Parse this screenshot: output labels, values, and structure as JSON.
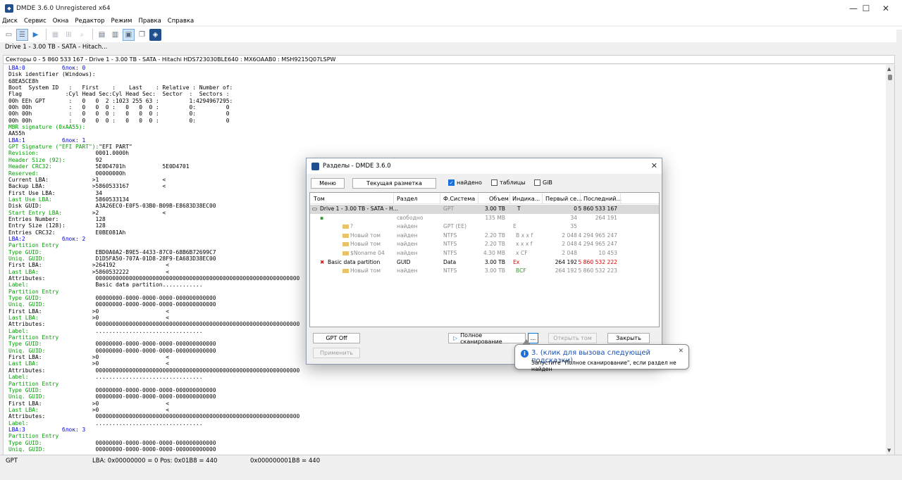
{
  "window": {
    "title": "DMDE 3.6.0 Unregistered x64",
    "icon": "dmde-app-icon",
    "min": "—",
    "max": "☐",
    "close": "✕"
  },
  "menu": [
    "Диск",
    "Сервис",
    "Окна",
    "Редактор",
    "Режим",
    "Правка",
    "Справка"
  ],
  "toolbar": {
    "icons": [
      "disk-icon",
      "list-view-icon",
      "play-icon",
      "grid-icon",
      "zoom-icon",
      "search-icon",
      "panel1-icon",
      "panel2-icon",
      "panel3-icon",
      "window-icon",
      "dmde-icon"
    ]
  },
  "doc_tab": "Drive 1 - 3.00 TB - SATA - Hitach...",
  "panel_header": "Секторы 0 - 5 860 533 167 - Drive 1 - 3.00 TB - SATA - Hitachi HDS723030BLE640 : MX6OAAB0 : MSH9215Q07LSPW",
  "hex_lines": [
    "LBA:0           блок: 0",
    "Disk identifier (Windows):",
    "68EA5CE8h",
    "Boot  System ID   :   First    :    Last    : Relative : Number of:",
    "Flag             :Cyl Head Sec:Cyl Head Sec:  Sector  :  Sectors :",
    "00h EEh GPT       :   0   0  2 :1023 255 63 :         1:4294967295:",
    "00h 00h           :   0   0  0 :   0   0  0 :         0:         0",
    "00h 00h           :   0   0  0 :   0   0  0 :         0:         0",
    "00h 00h           :   0   0  0 :   0   0  0 :         0:         0",
    "MBR signature (0xAA55):",
    "AA55h",
    "LBA:1           блок: 1",
    "GPT Signature (\"EFI PART\"):\"EFI PART\"",
    "Revision:                 0001.0000h",
    "Header Size (92):         92",
    "Header CRC32:             5E0D4701h           5E0D4701",
    "Reserved:                 00000000h",
    "Current LBA:             >1                   <",
    "Backup LBA:              >5860533167          <",
    "First Use LBA:            34",
    "Last Use LBA:             5860533134",
    "Disk GUID:                A3A26EC0-E0F5-03B0-B09B-E8683D38EC00",
    "Start Entry LBA:         >2                   <",
    "Entries Number:           128",
    "Entry Size (128):         128",
    "Entries CRC32:            E0BE081Ah",
    "LBA:2           блок: 2",
    "Partition Entry",
    "Type GUID:                EBD0A0A2-B9E5-4433-87C0-68B6B72699C7",
    "Uniq. GUID:               D1D5FA50-707A-01D8-28F9-EA683D38EC00",
    "First LBA:               >264192               <",
    "Last LBA:                >5860532222           <",
    "Attributes:               0000000000000000000000000000000000000000000000000000000000000",
    "Label:                    Basic data partition............",
    "Partition Entry",
    "Type GUID:                00000000-0000-0000-0000-000000000000",
    "Uniq. GUID:               00000000-0000-0000-0000-000000000000",
    "First LBA:               >0                    <",
    "Last LBA:                >0                    <",
    "Attributes:               0000000000000000000000000000000000000000000000000000000000000",
    "Label:                    ................................",
    "Partition Entry",
    "Type GUID:                00000000-0000-0000-0000-000000000000",
    "Uniq. GUID:               00000000-0000-0000-0000-000000000000",
    "First LBA:               >0                    <",
    "Last LBA:                >0                    <",
    "Attributes:               0000000000000000000000000000000000000000000000000000000000000",
    "Label:                    ................................",
    "Partition Entry",
    "Type GUID:                00000000-0000-0000-0000-000000000000",
    "Uniq. GUID:               00000000-0000-0000-0000-000000000000",
    "First LBA:               >0                    <",
    "Last LBA:                >0                    <",
    "Attributes:               0000000000000000000000000000000000000000000000000000000000000",
    "Label:                    ................................",
    "LBA:3           блок: 3",
    "Partition Entry",
    "Type GUID:                00000000-0000-0000-0000-000000000000",
    "Uniq. GUID:               00000000-0000-0000-0000-000000000000"
  ],
  "status": {
    "mode": "GPT",
    "pos": "LBA: 0x00000000 = 0  Pos: 0x01B8 = 440",
    "offset": "0x000000001B8 = 440"
  },
  "dialog": {
    "title": "Разделы - DMDE 3.6.0",
    "menu_btn": "Меню",
    "layout_btn": "Текущая разметка",
    "chk_found": "найдено",
    "chk_tables": "таблицы",
    "chk_gib": "GiB",
    "columns": [
      "Том",
      "Раздел",
      "Ф.Система",
      "Объем",
      "Индика...",
      "Первый се...",
      "Последний..."
    ],
    "rows": [
      {
        "name": "Drive 1 - 3.00 TB - SATA - H...",
        "part": "",
        "fs": "GPT",
        "size": "3.00 TB",
        "ind": "T",
        "first": "0",
        "last": "5 860 533 167",
        "sel": true
      },
      {
        "name": "",
        "part": "свободно",
        "fs": "",
        "size": "135 MB",
        "ind": "",
        "first": "34",
        "last": "264 191"
      },
      {
        "name": "?",
        "part": "найден",
        "fs": "GPT (EE)",
        "size": "",
        "ind": "E",
        "first": "35",
        "last": ""
      },
      {
        "name": "Новый том",
        "part": "найден",
        "fs": "NTFS",
        "size": "2.20 TB",
        "ind": "B x x f",
        "first": "2 048",
        "last": "4 294 965 247"
      },
      {
        "name": "Новый том",
        "part": "найден",
        "fs": "NTFS",
        "size": "2.20 TB",
        "ind": "x x x f",
        "first": "2 048",
        "last": "4 294 965 247"
      },
      {
        "name": "$Noname 04",
        "part": "найден",
        "fs": "NTFS",
        "size": "4.30 MB",
        "ind": "x CF",
        "first": "2 048",
        "last": "10 453"
      },
      {
        "name": "Basic data partition",
        "part": "GUID",
        "fs": "Data",
        "size": "3.00 TB",
        "ind": "Ex",
        "first": "264 192",
        "last": "5 860 532 222"
      },
      {
        "name": "Новый том",
        "part": "найден",
        "fs": "NTFS",
        "size": "3.00 TB",
        "ind": "BCF",
        "first": "264 192",
        "last": "5 860 532 223"
      }
    ],
    "gpt_btn": "GPT Off",
    "apply_btn": "Применить",
    "scan_btn": "Полное сканирование",
    "more_btn": "...",
    "open_btn": "Открыть том",
    "close_btn": "Закрыть"
  },
  "tooltip": {
    "title": "3. (клик для вызова следующей подсказки)",
    "text": "Запустите \"Полное сканирование\", если раздел не найден",
    "close": "✕",
    "icon": "info-icon"
  }
}
